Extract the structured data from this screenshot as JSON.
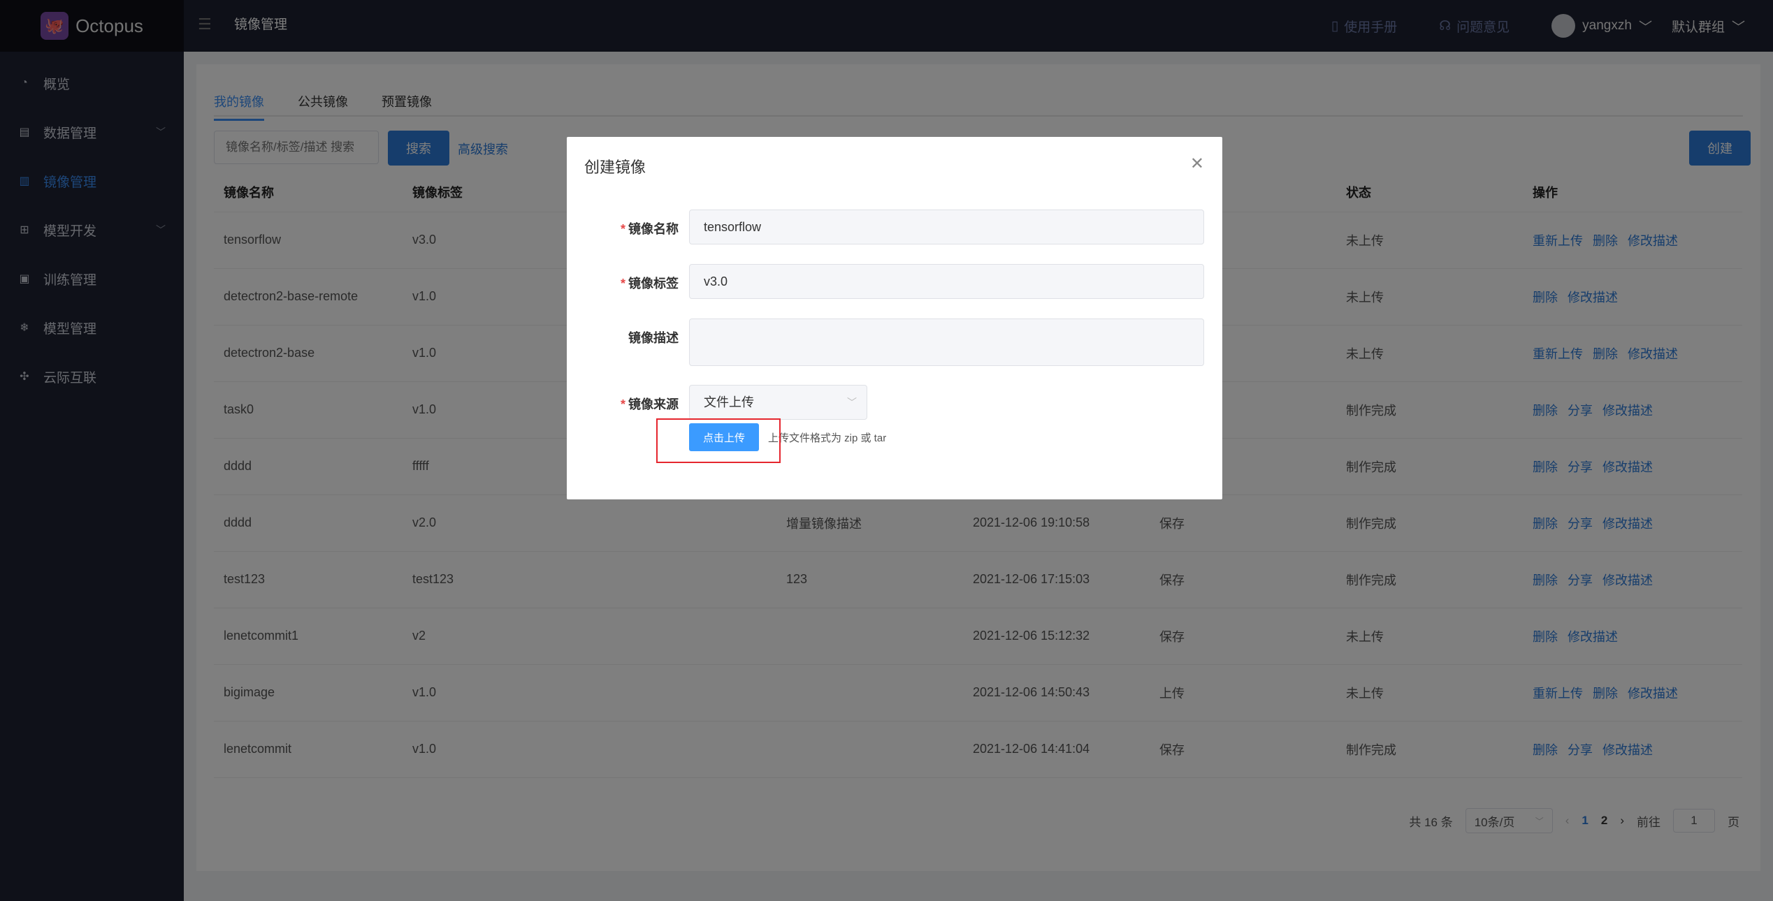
{
  "app": {
    "brand": "Octopus",
    "header_title": "镜像管理",
    "manual": "使用手册",
    "feedback": "问题意见",
    "user": "yangxzh",
    "group": "默认群组"
  },
  "sidebar": {
    "items": [
      {
        "label": "概览",
        "icon": "dashboard-icon"
      },
      {
        "label": "数据管理",
        "icon": "database-icon"
      },
      {
        "label": "镜像管理",
        "icon": "image-icon"
      },
      {
        "label": "模型开发",
        "icon": "grid-icon"
      },
      {
        "label": "训练管理",
        "icon": "training-icon"
      },
      {
        "label": "模型管理",
        "icon": "model-icon"
      },
      {
        "label": "云际互联",
        "icon": "network-icon"
      }
    ]
  },
  "tabs": [
    "我的镜像",
    "公共镜像",
    "预置镜像"
  ],
  "toolbar": {
    "search_placeholder": "镜像名称/标签/描述 搜索",
    "search_btn": "搜索",
    "advanced": "高级搜索",
    "create_btn": "创建"
  },
  "table": {
    "headers": [
      "镜像名称",
      "镜像标签",
      "",
      "",
      "",
      "状态",
      "操作"
    ],
    "rows": [
      {
        "name": "tensorflow",
        "tag": "v3.0",
        "desc": "",
        "time": "",
        "source": "",
        "status": "未上传",
        "ops": [
          "重新上传",
          "删除",
          "修改描述"
        ]
      },
      {
        "name": "detectron2-base-remote",
        "tag": "v1.0",
        "desc": "",
        "time": "",
        "source": "",
        "status": "未上传",
        "ops": [
          "删除",
          "修改描述"
        ]
      },
      {
        "name": "detectron2-base",
        "tag": "v1.0",
        "desc": "",
        "time": "",
        "source": "",
        "status": "未上传",
        "ops": [
          "重新上传",
          "删除",
          "修改描述"
        ]
      },
      {
        "name": "task0",
        "tag": "v1.0",
        "desc": "",
        "time": "",
        "source": "",
        "status": "制作完成",
        "ops": [
          "删除",
          "分享",
          "修改描述"
        ]
      },
      {
        "name": "dddd",
        "tag": "fffff",
        "desc": "",
        "time": "",
        "source": "",
        "status": "制作完成",
        "ops": [
          "删除",
          "分享",
          "修改描述"
        ]
      },
      {
        "name": "dddd",
        "tag": "v2.0",
        "desc": "增量镜像描述",
        "time": "2021-12-06 19:10:58",
        "source": "保存",
        "status": "制作完成",
        "ops": [
          "删除",
          "分享",
          "修改描述"
        ]
      },
      {
        "name": "test123",
        "tag": "test123",
        "desc": "123",
        "time": "2021-12-06 17:15:03",
        "source": "保存",
        "status": "制作完成",
        "ops": [
          "删除",
          "分享",
          "修改描述"
        ]
      },
      {
        "name": "lenetcommit1",
        "tag": "v2",
        "desc": "",
        "time": "2021-12-06 15:12:32",
        "source": "保存",
        "status": "未上传",
        "ops": [
          "删除",
          "修改描述"
        ]
      },
      {
        "name": "bigimage",
        "tag": "v1.0",
        "desc": "",
        "time": "2021-12-06 14:50:43",
        "source": "上传",
        "status": "未上传",
        "ops": [
          "重新上传",
          "删除",
          "修改描述"
        ]
      },
      {
        "name": "lenetcommit",
        "tag": "v1.0",
        "desc": "",
        "time": "2021-12-06 14:41:04",
        "source": "保存",
        "status": "制作完成",
        "ops": [
          "删除",
          "分享",
          "修改描述"
        ]
      }
    ]
  },
  "pager": {
    "total": "共 16 条",
    "page_size": "10条/页",
    "pages": [
      "1",
      "2"
    ],
    "goto_prefix": "前往",
    "goto_value": "1",
    "goto_suffix": "页"
  },
  "dialog": {
    "title": "创建镜像",
    "name_label": "镜像名称",
    "name_value": "tensorflow",
    "tag_label": "镜像标签",
    "tag_value": "v3.0",
    "desc_label": "镜像描述",
    "desc_value": "",
    "source_label": "镜像来源",
    "source_value": "文件上传",
    "upload_btn": "点击上传",
    "upload_hint": "上传文件格式为 zip 或 tar"
  }
}
